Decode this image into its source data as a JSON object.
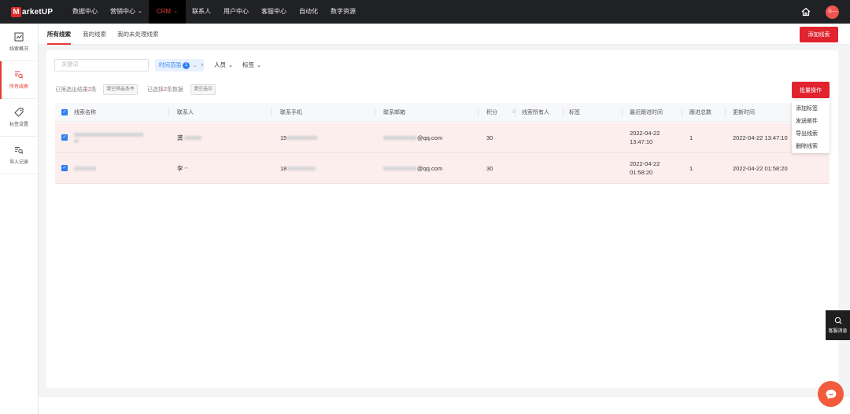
{
  "app": {
    "logo_mark": "M",
    "logo_text": "arketUP"
  },
  "nav": {
    "items": [
      {
        "label": "数据中心",
        "chevron": false
      },
      {
        "label": "营销中心",
        "chevron": true
      },
      {
        "label": "CRM",
        "chevron": true,
        "active": true
      },
      {
        "label": "联系人",
        "chevron": false
      },
      {
        "label": "用户中心",
        "chevron": false
      },
      {
        "label": "客服中心",
        "chevron": false
      },
      {
        "label": "自动化",
        "chevron": false
      },
      {
        "label": "数字资源",
        "chevron": false
      }
    ],
    "avatar_text": "Ｇ—"
  },
  "sidebar": {
    "items": [
      {
        "label": "线索概况",
        "icon": "line-chart-icon"
      },
      {
        "label": "所有线索",
        "icon": "list-search-icon",
        "active": true
      },
      {
        "label": "标签设置",
        "icon": "tag-icon"
      },
      {
        "label": "导入记录",
        "icon": "list-search-icon"
      }
    ]
  },
  "subtabs": {
    "items": [
      "所有线索",
      "我的线索",
      "我的未处理线索"
    ],
    "add_button": "添加线索"
  },
  "filters": {
    "keyword_placeholder": "关键词",
    "time_range": "时间范围",
    "time_range_count": "1",
    "people": "人员",
    "tags": "标签"
  },
  "stats": {
    "filtered_prefix": "已筛选出结果",
    "filtered_count": "2",
    "filtered_suffix": "条",
    "clear_filter": "清空筛选条件",
    "selected_prefix": "已选择",
    "selected_count": "2",
    "selected_suffix": "条数据",
    "clear_selected": "清空选中"
  },
  "batch": {
    "label": "批量操作",
    "menu": [
      "添加标签",
      "发送邮件",
      "导出线索",
      "删除线索"
    ]
  },
  "table": {
    "columns": [
      "线索名称",
      "联系人",
      "联系手机",
      "联系邮箱",
      "积分",
      "线索所有人",
      "标签",
      "最近跟进时间",
      "跟进总数",
      "更新时间"
    ],
    "rows": [
      {
        "contact": "龚",
        "phone": "15",
        "email": "@qq.com",
        "score": "30",
        "last_follow_date": "2022-04-22",
        "last_follow_time": "13:47:10",
        "follow_count": "1",
        "updated": "2022-04-22 13:47:10"
      },
      {
        "contact": "李",
        "phone": "18",
        "email": "@qq.com",
        "score": "30",
        "last_follow_date": "2022-04-22",
        "last_follow_time": "01:58:20",
        "follow_count": "1",
        "updated": "2022-04-22 01:58:20"
      }
    ]
  },
  "support": {
    "label": "客服消息"
  },
  "colors": {
    "accent": "#e0232e",
    "topbar": "#202124",
    "row_highlight": "#fdeeee",
    "link_blue": "#2f7ff0"
  }
}
